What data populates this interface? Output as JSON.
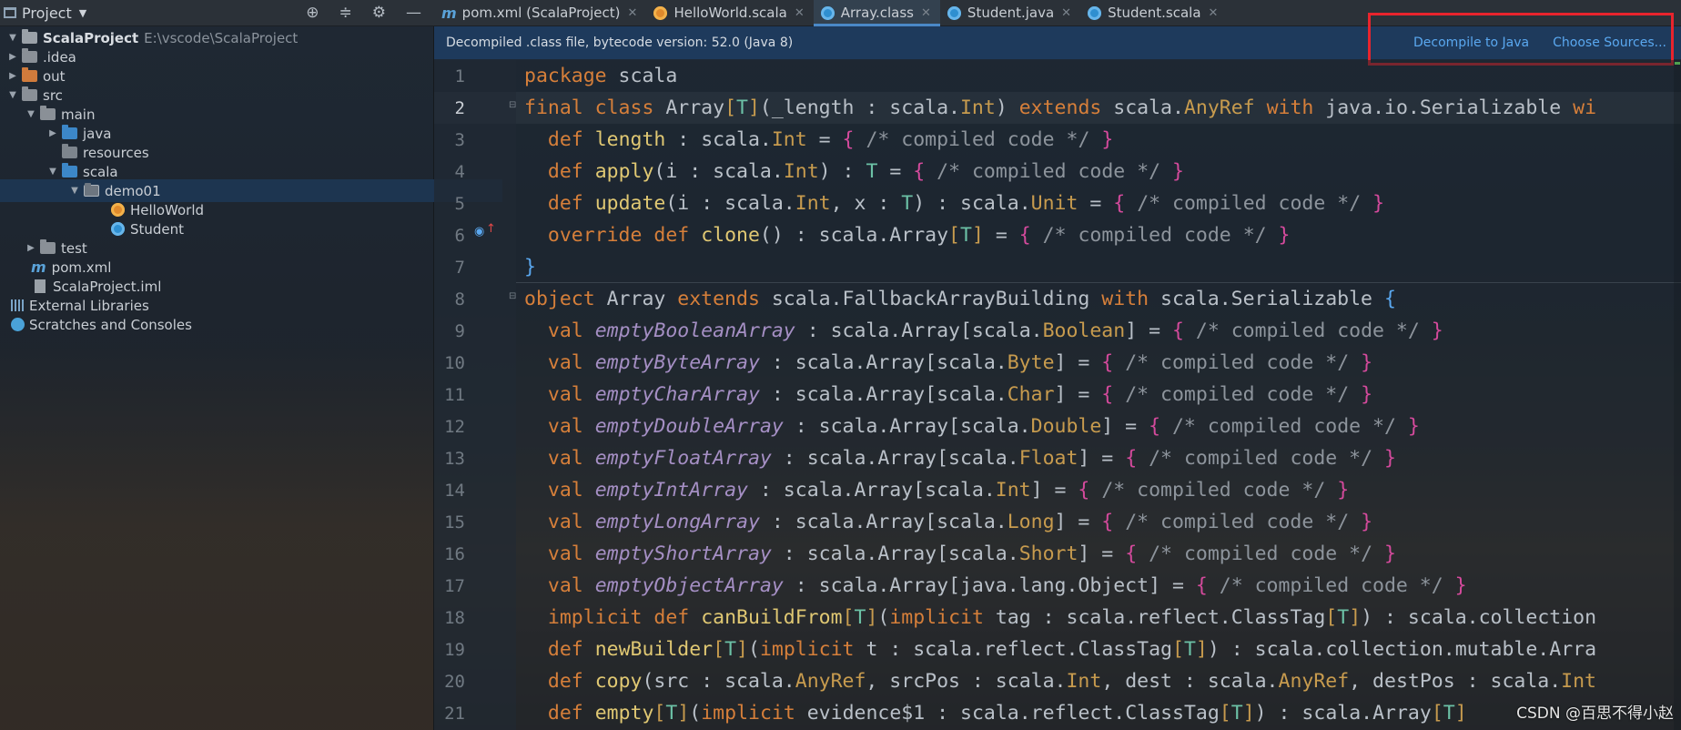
{
  "project_panel": {
    "title": "Project",
    "tree": [
      {
        "label": "ScalaProject",
        "detail": "E:\\vscode\\ScalaProject"
      },
      {
        "label": ".idea"
      },
      {
        "label": "out"
      },
      {
        "label": "src"
      },
      {
        "label": "main"
      },
      {
        "label": "java"
      },
      {
        "label": "resources"
      },
      {
        "label": "scala"
      },
      {
        "label": "demo01"
      },
      {
        "label": "HelloWorld"
      },
      {
        "label": "Student"
      },
      {
        "label": "test"
      },
      {
        "label": "pom.xml"
      },
      {
        "label": "ScalaProject.iml"
      },
      {
        "label": "External Libraries"
      },
      {
        "label": "Scratches and Consoles"
      }
    ]
  },
  "tabs": [
    {
      "label": "pom.xml (ScalaProject)",
      "icon": "maven-icon"
    },
    {
      "label": "HelloWorld.scala",
      "icon": "scala-object-icon"
    },
    {
      "label": "Array.class",
      "icon": "class-icon",
      "active": true
    },
    {
      "label": "Student.java",
      "icon": "java-class-icon"
    },
    {
      "label": "Student.scala",
      "icon": "scala-class-icon"
    }
  ],
  "notification": {
    "message": "Decompiled .class file, bytecode version: 52.0 (Java 8)",
    "decompile_link": "Decompile to Java",
    "sources_link": "Choose Sources..."
  },
  "editor": {
    "line_numbers": [
      "1",
      "2",
      "3",
      "4",
      "5",
      "6",
      "7",
      "8",
      "9",
      "10",
      "11",
      "12",
      "13",
      "14",
      "15",
      "16",
      "17",
      "18",
      "19",
      "20",
      "21"
    ],
    "current_line": 2
  },
  "watermark": "CSDN @百思不得小赵",
  "colors": {
    "keyword": "#d67f3a",
    "type": "#c79b4e",
    "type_param": "#6cc1a6",
    "comment": "#8d949c",
    "brace": "#d44a9c",
    "link": "#5aa8f0",
    "highlight_box": "#e8242d"
  }
}
